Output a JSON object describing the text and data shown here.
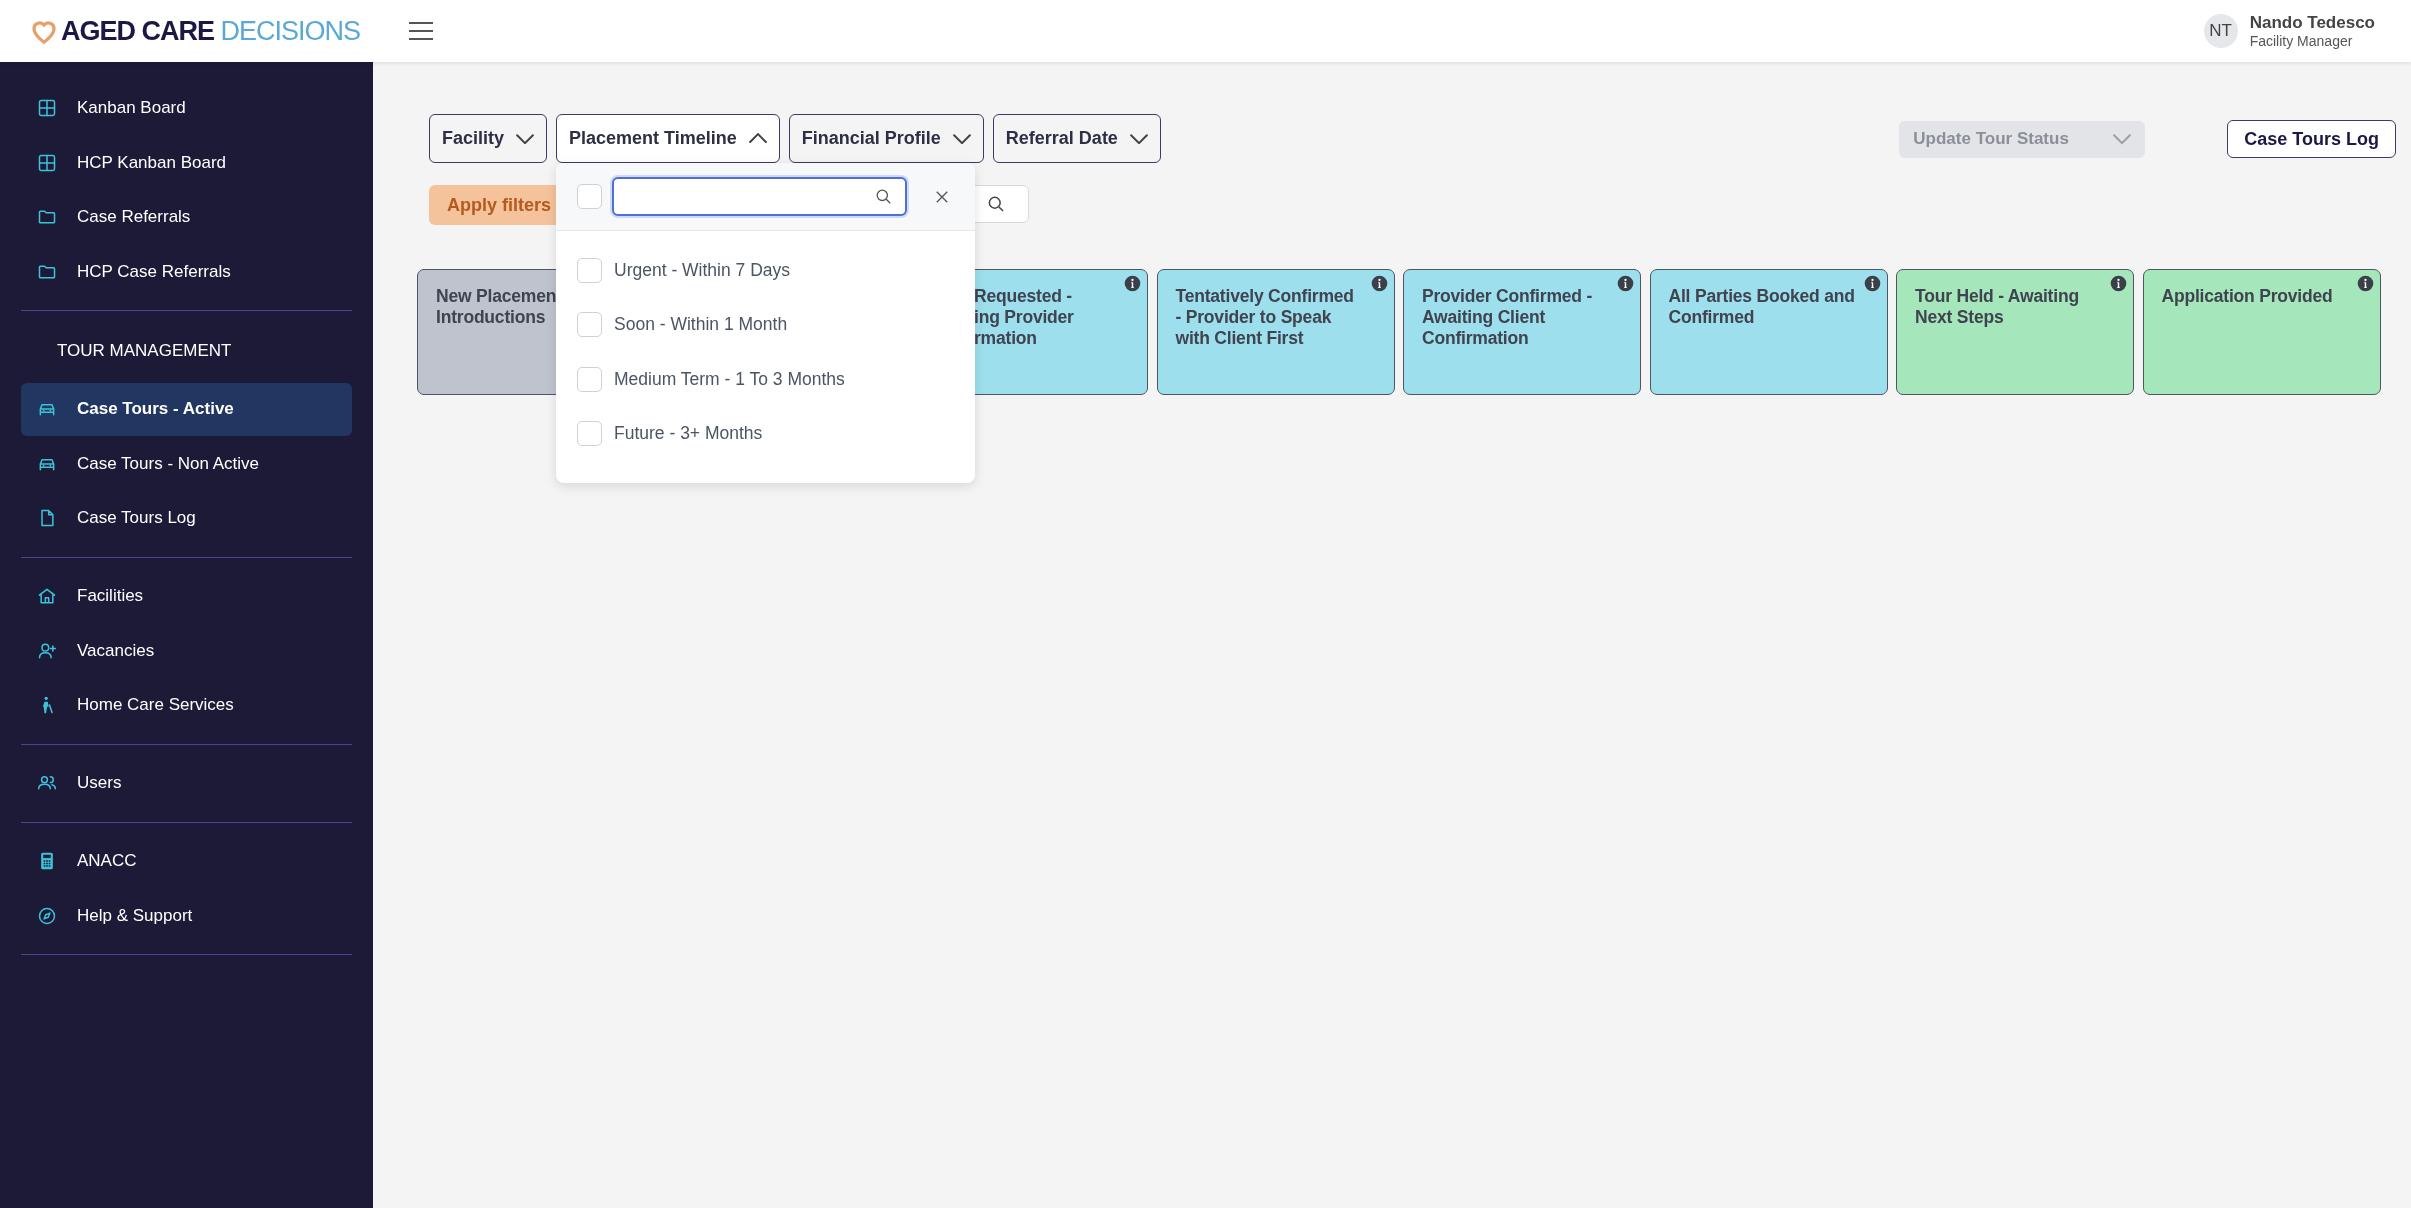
{
  "header": {
    "logo": {
      "part_1": "AGED CARE",
      "part_2": "DECISIONS"
    },
    "user": {
      "initials": "NT",
      "name": "Nando Tedesco",
      "role": "Facility Manager"
    }
  },
  "sidebar": {
    "sections": [
      {
        "items": [
          {
            "label": "Kanban Board",
            "selected": false
          },
          {
            "label": "HCP Kanban Board",
            "selected": false
          },
          {
            "label": "Case Referrals",
            "selected": false
          },
          {
            "label": "HCP Case Referrals",
            "selected": false
          }
        ]
      },
      {
        "heading": "TOUR MANAGEMENT",
        "items": [
          {
            "label": "Case Tours - Active",
            "selected": true
          },
          {
            "label": "Case Tours - Non Active",
            "selected": false
          },
          {
            "label": "Case Tours Log",
            "selected": false
          }
        ]
      },
      {
        "items": [
          {
            "label": "Facilities",
            "selected": false
          },
          {
            "label": "Vacancies",
            "selected": false
          },
          {
            "label": "Home Care Services",
            "selected": false
          }
        ]
      },
      {
        "items": [
          {
            "label": "Users",
            "selected": false
          }
        ]
      },
      {
        "items": [
          {
            "label": "ANACC",
            "selected": false
          },
          {
            "label": "Help & Support",
            "selected": false
          }
        ]
      }
    ]
  },
  "filters": [
    {
      "label": "Facility",
      "expanded": false
    },
    {
      "label": "Placement Timeline",
      "expanded": true
    },
    {
      "label": "Financial Profile",
      "expanded": false
    },
    {
      "label": "Referral Date",
      "expanded": false
    }
  ],
  "apply_button": "Apply filters",
  "update_status": {
    "label": "Update Tour Status",
    "disabled": true
  },
  "log_button": "Case Tours Log",
  "dropdown": {
    "select_all": false,
    "options": [
      {
        "label": "Urgent - Within 7 Days",
        "checked": false
      },
      {
        "label": "Soon - Within 1 Month",
        "checked": false
      },
      {
        "label": "Medium Term - 1 To 3 Months",
        "checked": false
      },
      {
        "label": "Future - 3+ Months",
        "checked": false
      }
    ]
  },
  "columns": [
    {
      "lines": [
        "New Placemen",
        "Introductions"
      ],
      "color": "#bfc3cd",
      "covered_left": false
    },
    {
      "lines": [
        "Requested -",
        "ing Provider",
        "rmation"
      ],
      "color": "#9ddfec",
      "info": true,
      "covered_left": true
    },
    {
      "lines": [
        "Tentatively Confirmed",
        "- Provider to Speak",
        "with Client First"
      ],
      "color": "#9ddfec",
      "info": true,
      "covered_left": false
    },
    {
      "lines": [
        "Provider Confirmed -",
        "Awaiting Client",
        "Confirmation"
      ],
      "color": "#9ddfec",
      "info": true,
      "covered_left": false
    },
    {
      "lines": [
        "All Parties Booked and",
        "Confirmed"
      ],
      "color": "#9ddfec",
      "info": true,
      "covered_left": false
    },
    {
      "lines": [
        "Tour Held - Awaiting",
        "Next Steps"
      ],
      "color": "#a6e6bb",
      "info": true,
      "covered_left": false
    },
    {
      "lines": [
        "Application Provided"
      ],
      "color": "#a6e6bb",
      "info": true,
      "covered_left": false
    }
  ]
}
